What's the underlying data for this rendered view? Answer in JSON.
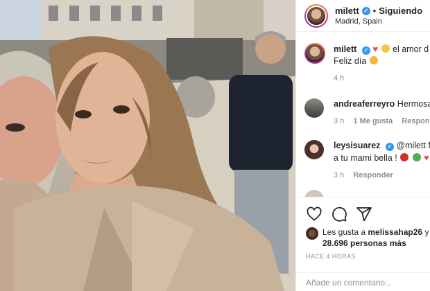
{
  "post": {
    "username": "milett",
    "separator": "•",
    "follow_status": "Siguiendo",
    "location": "Madrid, Spain"
  },
  "comments": [
    {
      "username": "milett",
      "text_after": "el amor d",
      "text_line2": "Feliz día",
      "time": "4 h",
      "emoji_colors": [
        "#ed4956",
        "#f4c542",
        "#f4c542"
      ]
    },
    {
      "username": "andreaferreyro",
      "text": "Hermosas",
      "time": "3 h",
      "likes": "1 Me gusta",
      "reply": "Responder"
    },
    {
      "username": "leysisuarez",
      "text": "@milett fel",
      "text_line2": "a tu mami bella !",
      "time": "3 h",
      "reply": "Responder",
      "emoji_colors": [
        "#d82b2b",
        "#4caf50",
        "#ed4956"
      ]
    }
  ],
  "actions": {
    "like_icon": "heart-icon",
    "comment_icon": "comment-icon",
    "share_icon": "share-icon"
  },
  "likes": {
    "prefix": "Les gusta a",
    "user": "melissahap26",
    "conj": "y",
    "count": "28.696 personas más"
  },
  "timestamp": "HACE 4 HORAS",
  "add_comment": {
    "placeholder": "Añade un comentario..."
  }
}
